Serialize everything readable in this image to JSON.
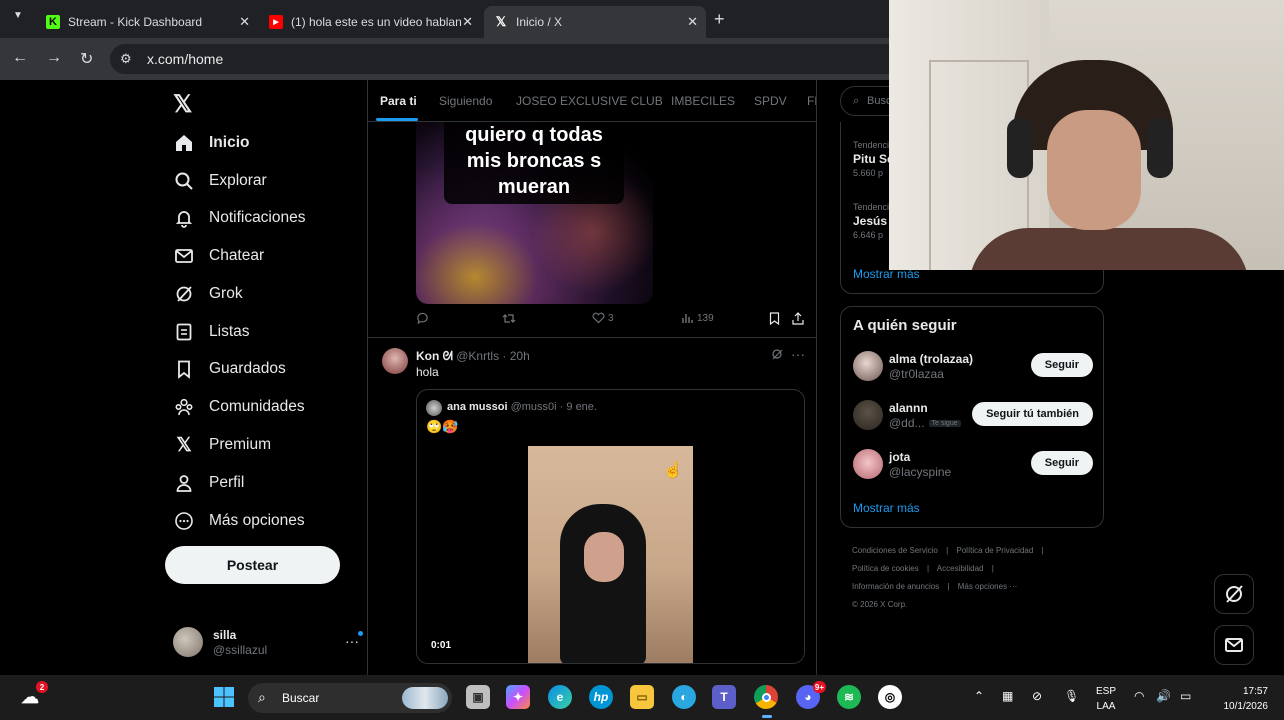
{
  "browser": {
    "tabs": [
      {
        "title": "Stream - Kick Dashboard",
        "icon": "kick-icon",
        "color": "#53fc18"
      },
      {
        "title": "(1) hola este es un video hablan",
        "icon": "youtube-icon",
        "color": "#ff0000"
      },
      {
        "title": "Inicio / X",
        "icon": "x-logo-icon",
        "color": "#ffffff"
      }
    ],
    "url": "x.com/home"
  },
  "nav": {
    "items": [
      {
        "label": "Inicio",
        "icon": "home-icon"
      },
      {
        "label": "Explorar",
        "icon": "search-icon"
      },
      {
        "label": "Notificaciones",
        "icon": "bell-icon"
      },
      {
        "label": "Chatear",
        "icon": "mail-icon"
      },
      {
        "label": "Grok",
        "icon": "grok-icon"
      },
      {
        "label": "Listas",
        "icon": "list-icon"
      },
      {
        "label": "Guardados",
        "icon": "bookmark-icon"
      },
      {
        "label": "Comunidades",
        "icon": "people-icon"
      },
      {
        "label": "Premium",
        "icon": "x-premium-icon"
      },
      {
        "label": "Perfil",
        "icon": "person-icon"
      },
      {
        "label": "Más opciones",
        "icon": "more-circle-icon"
      }
    ],
    "post_button": "Postear",
    "account": {
      "name": "silla",
      "handle": "@ssillazul"
    }
  },
  "timeline": {
    "tabs": [
      "Para ti",
      "Siguiendo",
      "JOSEO EXCLUSIVE CLUB",
      "IMBECILES",
      "SPDV",
      "FF"
    ],
    "post1": {
      "caption": "quiero q todas mis broncas s mueran",
      "likes": "3",
      "views": "139"
    },
    "post2": {
      "name": "Kon ᘛ",
      "handle": "@Knrtls",
      "time": "· 20h",
      "text": "hola",
      "quote": {
        "name": "ana mussoi",
        "handle": "@muss0i",
        "date": "· 9 ene.",
        "emoji": "🙄🥵",
        "video_time": "0:01"
      }
    }
  },
  "right": {
    "search_placeholder": "Busc",
    "trends": [
      {
        "context": "Tendencia",
        "title": "Pitu Se",
        "count": "5.660 p"
      },
      {
        "context": "Tendencia",
        "title": "Jesús M",
        "count": "6.646 p"
      }
    ],
    "trends_more": "Mostrar más",
    "follow": {
      "title": "A quién seguir",
      "items": [
        {
          "name": "alma (trolazaa)",
          "handle": "@tr0lazaa",
          "button": "Seguir",
          "badge": ""
        },
        {
          "name": "alannn",
          "handle": "@dd...",
          "button": "Seguir tú también",
          "badge": "Te sigue"
        },
        {
          "name": "jota",
          "handle": "@lacyspine",
          "button": "Seguir",
          "badge": ""
        }
      ],
      "more": "Mostrar más"
    },
    "footer": {
      "links": [
        "Condiciones de Servicio",
        "|",
        "Política de Privacidad",
        "|",
        "Política de cookies",
        "|",
        "Accesibilidad",
        "|",
        "Información de anuncios",
        "|",
        "Más opciones ···"
      ],
      "copyright": "© 2026 X Corp."
    }
  },
  "taskbar": {
    "search_label": "Buscar",
    "lang_1": "ESP",
    "lang_2": "LAA",
    "time": "17:57",
    "date": "10/1/2026",
    "weather_badge": "2",
    "discord_badge": "9+"
  }
}
